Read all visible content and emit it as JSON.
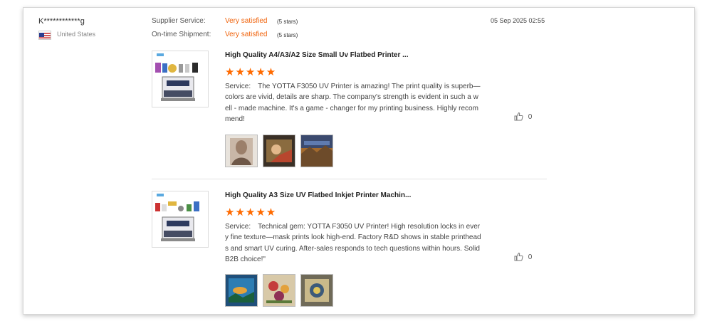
{
  "reviewer": {
    "name": "K************g",
    "country": "United States",
    "flag_icon": "us-flag-icon"
  },
  "ratings": {
    "supplier_service": {
      "label": "Supplier Service:",
      "value": "Very satisfied",
      "stars": "(5 stars)"
    },
    "on_time_shipment": {
      "label": "On-time Shipment:",
      "value": "Very satisfied",
      "stars": "(5 stars)"
    }
  },
  "date": "05 Sep 2025 02:55",
  "accent_color": "#ff6a00",
  "reviews": [
    {
      "product_title": "High Quality A4/A3/A2 Size Small Uv Flatbed Printer ...",
      "rating": 5,
      "stars": "★★★★★",
      "text": "Service:　The YOTTA F3050 UV Printer is amazing! The print quality is superb—colors are vivid, details are sharp. The company's strength is evident in such a well - made machine. It's a game - changer for my printing business. Highly recommend!",
      "likes": "0",
      "photos": [
        "portrait-print-photo",
        "painting-print-photo",
        "landscape-print-photo"
      ]
    },
    {
      "product_title": "High Quality A3 Size UV Flatbed Inkjet Printer Machin...",
      "rating": 5,
      "stars": "★★★★★",
      "text": "Service:　Technical gem: YOTTA F3050 UV Printer! High resolution locks in every fine texture—mask prints look high-end. Factory R&D shows in stable printheads and smart UV curing. After-sales responds to tech questions within hours. Solid B2B choice!\"",
      "likes": "0",
      "photos": [
        "sea-print-photo",
        "floral-print-photo",
        "decor-print-photo"
      ]
    }
  ]
}
